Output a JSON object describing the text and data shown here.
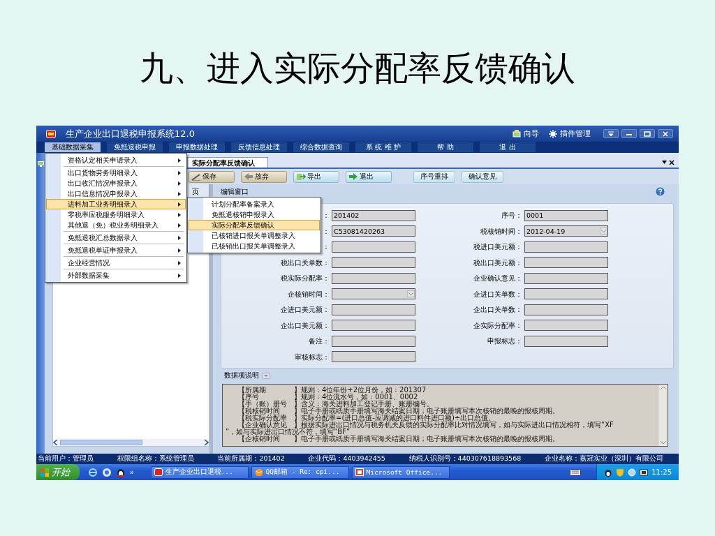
{
  "slide": {
    "title": "九、进入实际分配率反馈确认"
  },
  "window": {
    "title": "生产企业出口退税申报系统12.0",
    "header_links": [
      "向导",
      "插件管理"
    ]
  },
  "menubar": [
    {
      "label": "基础数据采集",
      "selected": true
    },
    {
      "label": "免抵退税申报",
      "selected": false
    },
    {
      "label": "申报数据处理",
      "selected": false
    },
    {
      "label": "反馈信息处理",
      "selected": false
    },
    {
      "label": "综合数据查询",
      "selected": false
    },
    {
      "label": "系 统 维 护",
      "selected": false
    },
    {
      "label": "帮 助",
      "selected": false
    },
    {
      "label": "退 出",
      "selected": false
    }
  ],
  "dropdown_menu": {
    "groups": [
      {
        "items": [
          {
            "label": "资格认定相关申请录入",
            "selected": false
          }
        ]
      },
      {
        "items": [
          {
            "label": "出口货物劳务明细录入",
            "selected": false
          },
          {
            "label": "出口收汇情况申报录入",
            "selected": false
          },
          {
            "label": "出口信息情况申报录入",
            "selected": false
          },
          {
            "label": "进料加工业务明细录入",
            "selected": true
          },
          {
            "label": "零税率应税服务明细录入",
            "selected": false
          },
          {
            "label": "其他退（免）税业务明细录入",
            "selected": false
          }
        ]
      },
      {
        "items": [
          {
            "label": "免抵退税汇总数据录入",
            "selected": false
          }
        ]
      },
      {
        "items": [
          {
            "label": "免抵退税单证申报录入",
            "selected": false
          }
        ]
      },
      {
        "items": [
          {
            "label": "企业经营情况",
            "selected": false
          }
        ]
      },
      {
        "items": [
          {
            "label": "外部数据采集",
            "selected": false
          }
        ]
      }
    ]
  },
  "submenu": {
    "items": [
      {
        "label": "计划分配率备案录入",
        "selected": false
      },
      {
        "label": "免抵退核销申报录入",
        "selected": false
      },
      {
        "label": "实际分配率反馈确认",
        "selected": true
      },
      {
        "label": "已核销进口报关单调整录入",
        "selected": false
      },
      {
        "label": "已核销出口报关单调整录入",
        "selected": false
      }
    ]
  },
  "tab": {
    "label": "实际分配率反馈确认"
  },
  "toolbar": [
    {
      "label": "保存",
      "kind": "save"
    },
    {
      "label": "放弃",
      "kind": "discard"
    },
    {
      "label": "导出",
      "kind": "export"
    },
    {
      "label": "退出",
      "kind": "exit"
    },
    {
      "label": "序号重排",
      "kind": "plain"
    },
    {
      "label": "确认意见",
      "kind": "plain"
    }
  ],
  "list_panel": {
    "column_header": "页"
  },
  "edit_pane": {
    "title": "编辑窗口",
    "fields": [
      {
        "label": "：",
        "value": "201402",
        "kind": "text"
      },
      {
        "label": "序号：",
        "value": "0001",
        "kind": "text"
      },
      {
        "label": "：",
        "value": "C53081420263",
        "kind": "text"
      },
      {
        "label": "税核销时间：",
        "value": "2012-04-19",
        "kind": "dropdown"
      },
      {
        "label": "：",
        "kind": "text"
      },
      {
        "label": "税进口美元额：",
        "kind": "text"
      },
      {
        "label": "税出口关单数：",
        "kind": "text"
      },
      {
        "label": "税出口美元额：",
        "kind": "text"
      },
      {
        "label": "税实际分配率：",
        "kind": "text"
      },
      {
        "label": "企业确认意见：",
        "kind": "text"
      },
      {
        "label": "企核销时间：",
        "kind": "dropdown"
      },
      {
        "label": "企进口关单数：",
        "kind": "text"
      },
      {
        "label": "企进口美元额：",
        "kind": "text"
      },
      {
        "label": "企出口关单数：",
        "kind": "text"
      },
      {
        "label": "企出口美元额：",
        "kind": "text"
      },
      {
        "label": "企实际分配率：",
        "kind": "text"
      },
      {
        "label": "备注：",
        "kind": "text"
      },
      {
        "label": "申报标志：",
        "kind": "text"
      },
      {
        "label": "审核标志：",
        "kind": "text"
      }
    ]
  },
  "notes": {
    "title": "数据项说明",
    "lines": [
      {
        "key": "【所属期",
        "text": "】规则：4位年份+2位月份，如：201307"
      },
      {
        "key": "【序号",
        "text": "】规则：4位流水号，如：0001、0002"
      },
      {
        "key": "【手（账）册号",
        "text": "】含义：海关进料加工登记手册、账册编号。"
      },
      {
        "key": "【税核销时间",
        "text": "】电子手册或纸质手册填写海关结案日期；电子账册填写本次核销的最晚的报核周期。"
      },
      {
        "key": "【税实际分配率",
        "text": "】实际分配率=(进口总值-应调减的进口料件进口额)÷出口总值。"
      },
      {
        "key": "【企业确认意见",
        "text": "】根据实际进出口情况与税务机关反馈的实际分配率比对情况填写，如与实际进出口情况相符，填写“XF"
      },
      {
        "text": "”，如与实际进出口情况不符，填写“BF”"
      },
      {
        "key": "【企核销时间",
        "text": "】电子手册或纸质手册填写海关结案日期；电子账册填写本次核销的最晚的报核周期。"
      }
    ]
  },
  "status_bar": [
    "当前用户：管理员",
    "权限组名称：系统管理员",
    "当前所属期：201402",
    "企业代码：4403942455",
    "纳税人识别号：440307618893568",
    "企业名称：嘉冠实业（深圳）有限公司"
  ],
  "taskbar": {
    "start": "开始",
    "more": "»",
    "tasks": [
      {
        "label": "生产企业出口退税...",
        "kind": "app"
      },
      {
        "label": "QQ邮箱 - Re: cpi...",
        "kind": "mail"
      },
      {
        "label": "Microsoft Office...",
        "kind": "office"
      }
    ],
    "clock": "11:25"
  }
}
